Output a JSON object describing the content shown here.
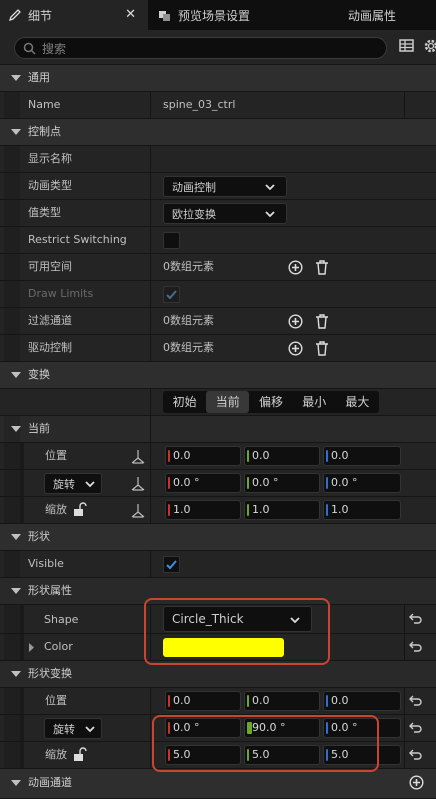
{
  "tabs": [
    {
      "label": "细节",
      "close": "✕"
    },
    {
      "label": "预览场景设置"
    },
    {
      "label": "动画属性"
    }
  ],
  "search": {
    "placeholder": "搜索"
  },
  "sections": {
    "general": "通用",
    "control_point": "控制点",
    "transform": "变换",
    "current_group": "当前",
    "shape": "形状",
    "shape_props": "形状属性",
    "shape_transform": "形状变换",
    "anim_channel": "动画通道"
  },
  "general": {
    "name_label": "Name",
    "name_value": "spine_03_ctrl"
  },
  "control": {
    "display_name_label": "显示名称",
    "anim_type_label": "动画类型",
    "anim_type_value": "动画控制",
    "value_type_label": "值类型",
    "value_type_value": "欧拉变换",
    "restrict_label": "Restrict Switching",
    "avail_space_label": "可用空间",
    "avail_space_value": "0数组元素",
    "draw_limits_label": "Draw Limits",
    "filter_label": "过滤通道",
    "filter_value": "0数组元素",
    "drive_label": "驱动控制",
    "drive_value": "0数组元素"
  },
  "transform": {
    "modes": [
      "初始",
      "当前",
      "偏移",
      "最小",
      "最大"
    ],
    "selected": "当前"
  },
  "current": {
    "location_label": "位置",
    "location": [
      "0.0",
      "0.0",
      "0.0"
    ],
    "rotation_label": "旋转",
    "rotation": [
      "0.0 °",
      "0.0 °",
      "0.0 °"
    ],
    "scale_label": "缩放",
    "scale": [
      "1.0",
      "1.0",
      "1.0"
    ]
  },
  "shape": {
    "visible_label": "Visible"
  },
  "shape_props": {
    "shape_label": "Shape",
    "shape_value": "Circle_Thick",
    "color_label": "Color",
    "color": "#ffff00"
  },
  "shape_transform": {
    "location_label": "位置",
    "location": [
      "0.0",
      "0.0",
      "0.0"
    ],
    "rotation_label": "旋转",
    "rotation": [
      "0.0 °",
      "90.0 °",
      "0.0 °"
    ],
    "scale_label": "缩放",
    "scale": [
      "5.0",
      "5.0",
      "5.0"
    ]
  },
  "colors": {
    "x": "#c8342a",
    "y": "#6aa82c",
    "z": "#2f6fd0",
    "highlight": "#c8452e"
  }
}
